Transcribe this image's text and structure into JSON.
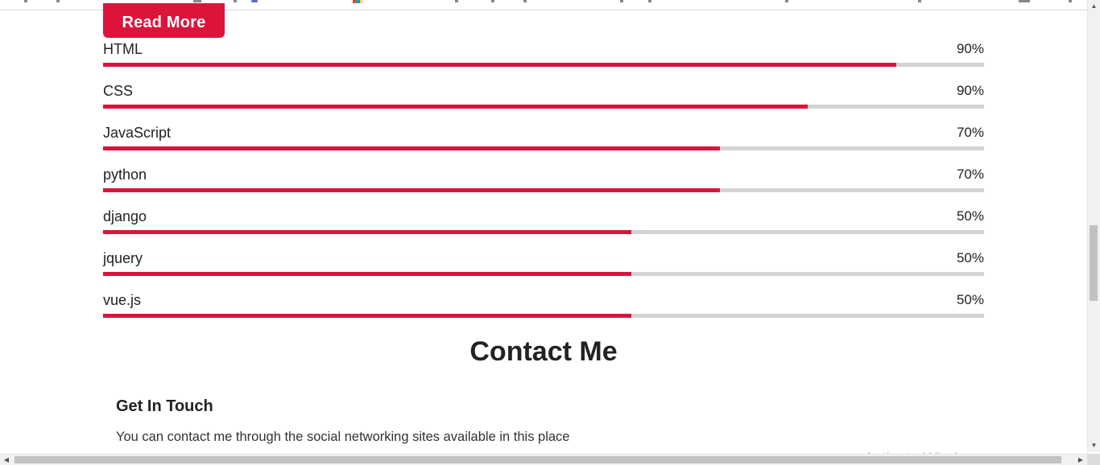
{
  "header": {
    "read_more_label": "Read More"
  },
  "skills": [
    {
      "name": "HTML",
      "percent_label": "90%",
      "fill": 0.9
    },
    {
      "name": "CSS",
      "percent_label": "90%",
      "fill": 0.8
    },
    {
      "name": "JavaScript",
      "percent_label": "70%",
      "fill": 0.7
    },
    {
      "name": "python",
      "percent_label": "70%",
      "fill": 0.7
    },
    {
      "name": "django",
      "percent_label": "50%",
      "fill": 0.6
    },
    {
      "name": "jquery",
      "percent_label": "50%",
      "fill": 0.6
    },
    {
      "name": "vue.js",
      "percent_label": "50%",
      "fill": 0.6
    }
  ],
  "contact": {
    "title": "Contact Me",
    "subtitle": "Get In Touch",
    "text": "You can contact me through the social networking sites available in this place"
  },
  "watermark": {
    "text": "Activate Windows"
  },
  "colors": {
    "accent": "#dc143c",
    "track": "#d3d3d3",
    "text": "#222222"
  },
  "icons": {
    "scroll_up": "chevron-up-icon",
    "scroll_down": "chevron-down-icon",
    "scroll_left": "chevron-left-icon",
    "scroll_right": "chevron-right-icon"
  }
}
